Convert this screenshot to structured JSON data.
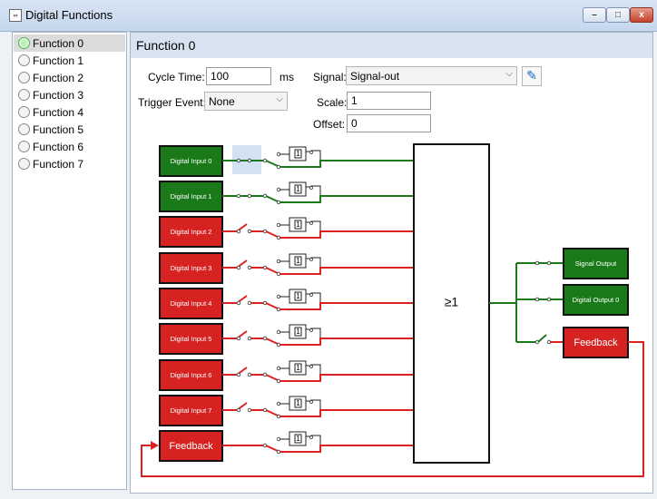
{
  "window": {
    "title": "Digital Functions",
    "controls": {
      "minimize": "–",
      "maximize": "□",
      "close": "x"
    }
  },
  "sidebar": {
    "items": [
      {
        "label": "Function 0",
        "selected": true
      },
      {
        "label": "Function 1",
        "selected": false
      },
      {
        "label": "Function 2",
        "selected": false
      },
      {
        "label": "Function 3",
        "selected": false
      },
      {
        "label": "Function 4",
        "selected": false
      },
      {
        "label": "Function 5",
        "selected": false
      },
      {
        "label": "Function 6",
        "selected": false
      },
      {
        "label": "Function 7",
        "selected": false
      }
    ]
  },
  "main": {
    "title": "Function 0",
    "cycle_time": {
      "label": "Cycle Time:",
      "value": "100",
      "unit": "ms"
    },
    "trigger_event": {
      "label": "Trigger Event:",
      "value": "None"
    },
    "signal": {
      "label": "Signal:",
      "value": "Signal-out"
    },
    "scale": {
      "label": "Scale:",
      "value": "1"
    },
    "offset": {
      "label": "Offset:",
      "value": "0"
    }
  },
  "diagram": {
    "colors": {
      "on": "#1a7a1a",
      "off": "#d72222",
      "line_on": "#1a7a1a",
      "line_off": "#dd2020"
    },
    "inputs": [
      {
        "label": "Digital Input 0",
        "state": "on"
      },
      {
        "label": "Digital Input 1",
        "state": "on"
      },
      {
        "label": "Digital Input 2",
        "state": "off"
      },
      {
        "label": "Digital Input 3",
        "state": "off"
      },
      {
        "label": "Digital Input 4",
        "state": "off"
      },
      {
        "label": "Digital Input 5",
        "state": "off"
      },
      {
        "label": "Digital Input 6",
        "state": "off"
      },
      {
        "label": "Digital Input 7",
        "state": "off"
      },
      {
        "label": "Feedback",
        "state": "off"
      }
    ],
    "gate_label": "≥1",
    "delay_label": "1",
    "outputs": [
      {
        "label": "Signal Output",
        "state": "on"
      },
      {
        "label": "Digital Output 0",
        "state": "on"
      },
      {
        "label": "Feedback",
        "state": "off"
      }
    ]
  }
}
